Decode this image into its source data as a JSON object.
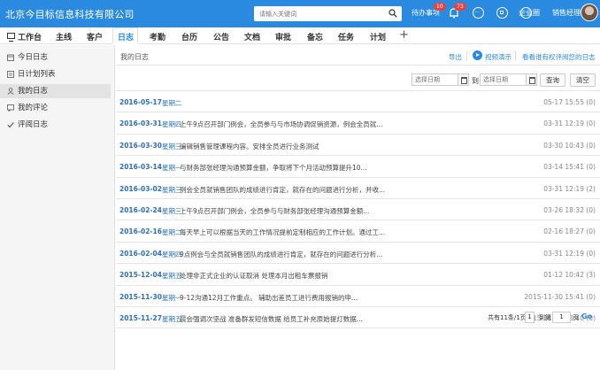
{
  "topbar": {
    "company": "北京今目标信息科技有限公司",
    "search_placeholder": "请输入关键词",
    "todo_label": "待办事项",
    "todo_badge": "10",
    "notify_badge": "73",
    "enterprise_label": "企业圈",
    "user_label": "销售经理"
  },
  "nav": {
    "tabs": [
      "工作台",
      "主线",
      "客户",
      "日志",
      "考勤",
      "台历",
      "公告",
      "文档",
      "审批",
      "备忘",
      "任务",
      "计划"
    ],
    "plus": "+"
  },
  "sidebar": {
    "items": [
      "今日日志",
      "日计划列表",
      "我的日志",
      "我的评论",
      "评阅日志"
    ]
  },
  "main": {
    "title": "我的日志",
    "export_label": "导出",
    "video_label": "视频演示",
    "permission_label": "看看谁有权评阅您的日志",
    "start_placeholder": "选择日期",
    "to_label": "到",
    "end_placeholder": "选择日期",
    "query_label": "查询",
    "clear_label": "清空"
  },
  "logs": [
    {
      "date": "2016-05-17",
      "week": "星期二",
      "content": "",
      "time": "05-17 15:55 (0)"
    },
    {
      "date": "2016-03-31",
      "week": "星期四",
      "content": "上午9点召开部门例会，全员参与与市场协调促销资源，例会全员就...",
      "time": "03-31 12:19 (0)"
    },
    {
      "date": "2016-03-30",
      "week": "星期三",
      "content": "编辑销售管理课程内容。安排全员进行业务测试",
      "time": "03-30 10:43 (0)"
    },
    {
      "date": "2016-03-14",
      "week": "星期一",
      "content": "与财务部张经理沟通预算金额，争取将下个月活动预算提升10...",
      "time": "03-14 15:41 (0)"
    },
    {
      "date": "2016-03-02",
      "week": "星期三",
      "content": "例会全员就销售团队的成绩进行肯定，就存在的问题进行分析，并收...",
      "time": "03-31 12:19 (2)"
    },
    {
      "date": "2016-02-24",
      "week": "星期三",
      "content": "上午9点召开部门例会，全员参与与财务部张经理沟通预算金额...",
      "time": "03-26 18:32 (0)"
    },
    {
      "date": "2016-02-16",
      "week": "星期二",
      "content": "每天早上可以根据当天的工作情况提前定制相应的工作计划。通过工...",
      "time": "02-16 18:27 (0)"
    },
    {
      "date": "2016-02-04",
      "week": "星期四",
      "content": "9点例会与全员就销售团队的成绩进行肯定，就存在的问题进行分析...",
      "time": "03-31 12:19 (0)"
    },
    {
      "date": "2015-12-04",
      "week": "星期五",
      "content": "处理非正式企业的认证取消 处理本月出租车票报销",
      "time": "01-12 10:42 (3)"
    },
    {
      "date": "2015-11-30",
      "week": "星期一",
      "content": "9-12沟通12月工作重点。 辅助出差员工进行费用报销的申...",
      "time": "2015-11-30 15:41 (0)"
    },
    {
      "date": "2015-11-27",
      "week": "星期五",
      "content": "晨会强调次坚战 准备群发短信数据 给员工补充原始提灯数据...",
      "time": "2015-11-27 13:40 (0)"
    }
  ],
  "pager": {
    "summary": "共有11条/1页",
    "current": "1",
    "goto_label": "到第",
    "page_input": "1",
    "page_unit": "页",
    "go_label": "Go"
  }
}
